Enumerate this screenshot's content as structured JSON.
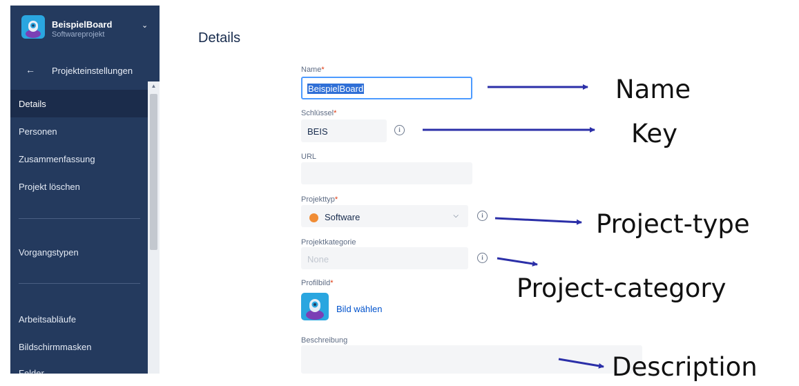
{
  "sidebar": {
    "project_name": "BeispielBoard",
    "project_type": "Softwareprojekt",
    "back_label": "Projekteinstellungen",
    "items": [
      {
        "label": "Details",
        "active": true
      },
      {
        "label": "Personen"
      },
      {
        "label": "Zusammenfassung"
      },
      {
        "label": "Projekt löschen"
      },
      {
        "label": "Vorgangstypen"
      },
      {
        "label": "Arbeitsabläufe"
      },
      {
        "label": "Bildschirmmasken"
      },
      {
        "label": "Felder"
      }
    ]
  },
  "main": {
    "title": "Details",
    "required_mark": "*",
    "name": {
      "label": "Name",
      "value": "BeispielBoard"
    },
    "key": {
      "label": "Schlüssel",
      "value": "BEIS"
    },
    "url": {
      "label": "URL",
      "value": ""
    },
    "project_type": {
      "label": "Projekttyp",
      "value": "Software"
    },
    "project_category": {
      "label": "Projektkategorie",
      "placeholder": "None"
    },
    "avatar": {
      "label": "Profilbild",
      "button_label": "Bild wählen"
    },
    "description": {
      "label": "Beschreibung",
      "value": ""
    }
  },
  "annotations": {
    "name": "Name",
    "key": "Key",
    "project_type": "Project-type",
    "project_category": "Project-category",
    "description": "Description"
  },
  "colors": {
    "sidebar_bg": "#243a5e",
    "accent": "#0052cc",
    "focus_border": "#4c9aff",
    "required": "#de350b",
    "arrow": "#2b2fa8",
    "project_type_dot": "#f08c35"
  },
  "icons": {
    "project_avatar": "rocket-avatar-icon",
    "back": "arrow-left-icon",
    "dropdown": "chevron-down-icon",
    "info": "info-icon"
  }
}
